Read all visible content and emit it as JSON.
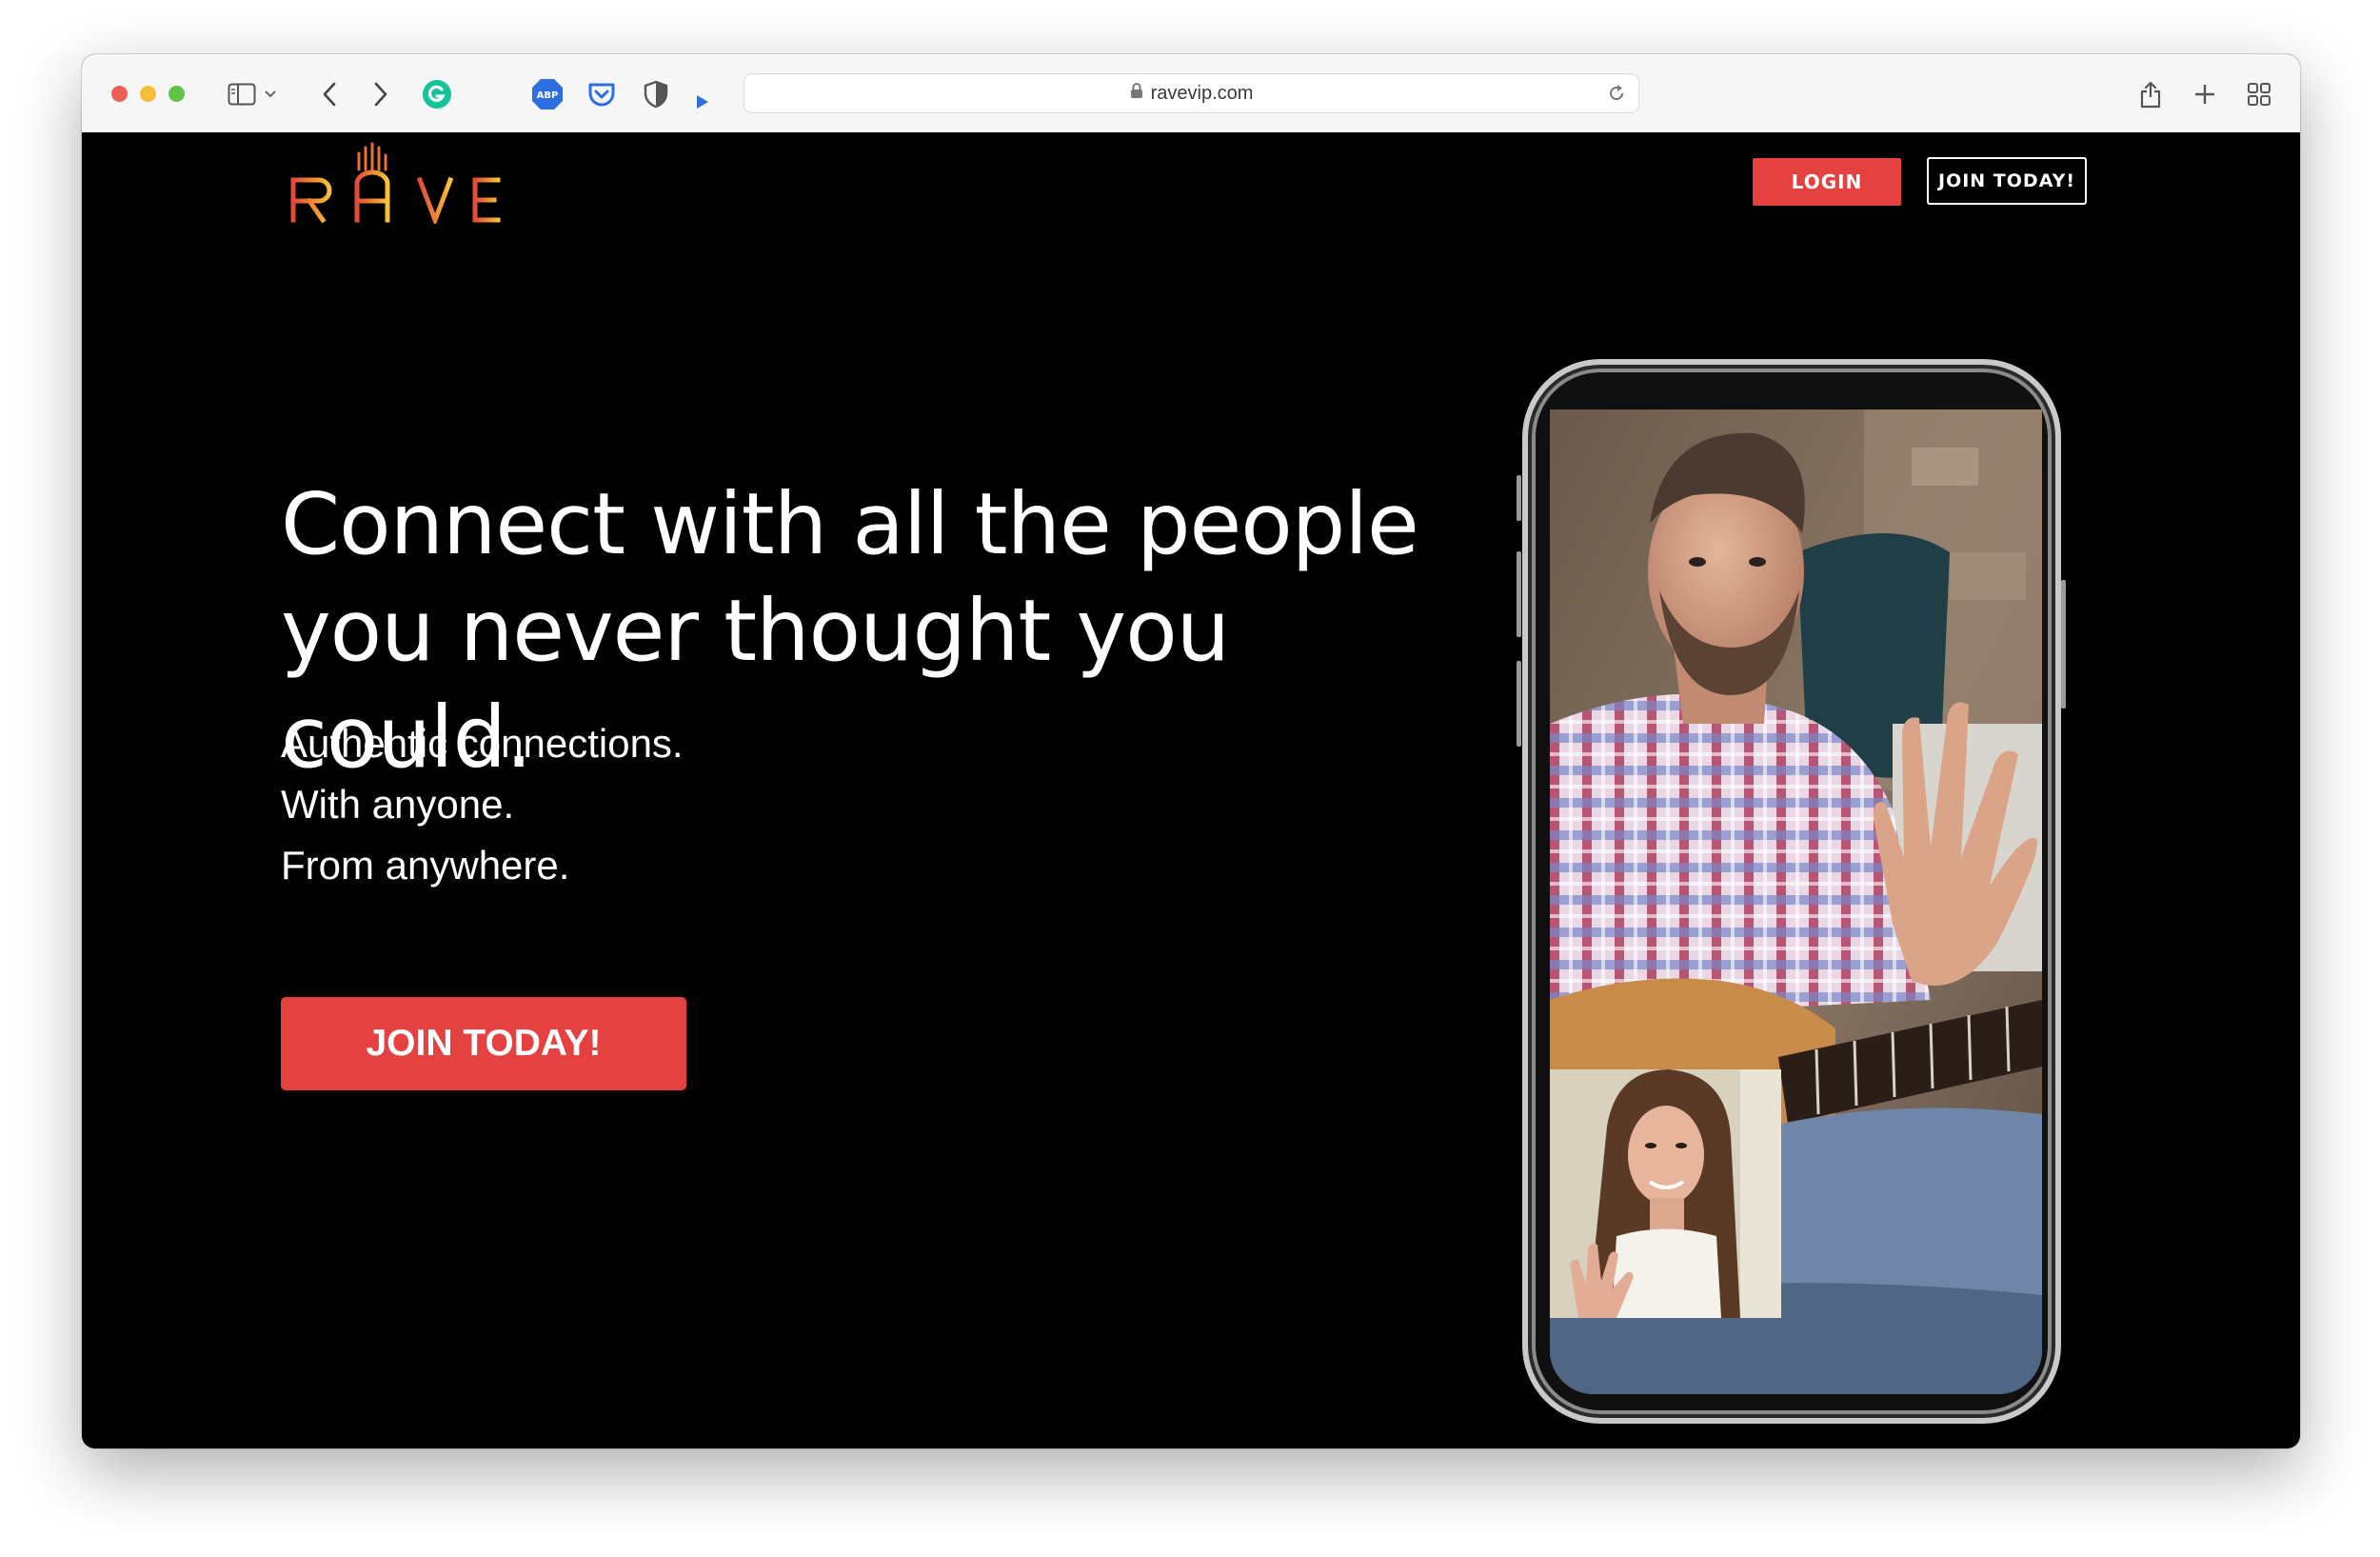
{
  "browser": {
    "url": "ravevip.com",
    "extensions": {
      "adblock_label": "ABP"
    }
  },
  "site": {
    "logo_text": "RAVE",
    "nav": {
      "login_label": "LOGIN",
      "join_label": "JOIN TODAY!"
    },
    "hero": {
      "headline_line1": "Connect with all the people",
      "headline_line2": "you never thought you could.",
      "tagline": [
        "Authentic connections.",
        "With anyone.",
        "From anywhere."
      ],
      "cta_label": "JOIN TODAY!"
    }
  },
  "colors": {
    "accent_red": "#e54141",
    "logo_red": "#e34a3a",
    "logo_orange": "#f08a30",
    "logo_yellow": "#f5c33b",
    "page_background": "#000000"
  },
  "icons": [
    "sidebar-icon",
    "chevron-down-icon",
    "back-arrow-icon",
    "forward-arrow-icon",
    "grammarly-icon",
    "adblock-plus-icon",
    "pocket-icon",
    "privacy-shield-icon",
    "play-extension-icon",
    "lock-icon",
    "reload-icon",
    "share-icon",
    "new-tab-plus-icon",
    "tab-overview-icon"
  ]
}
